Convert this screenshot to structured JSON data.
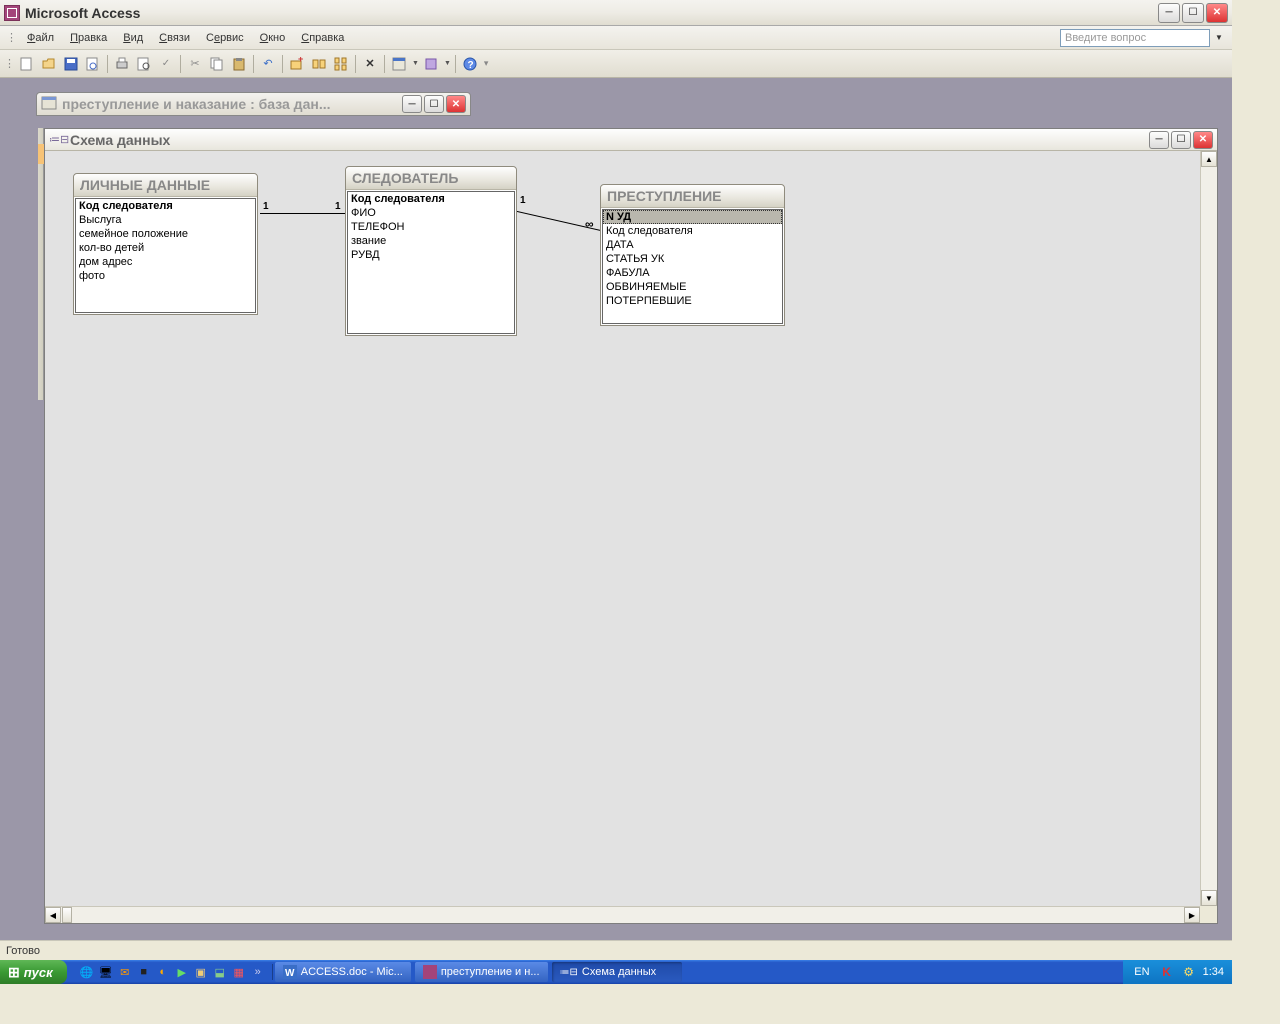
{
  "app": {
    "title": "Microsoft Access"
  },
  "menu": {
    "file": "Файл",
    "edit": "Правка",
    "view": "Вид",
    "relations": "Связи",
    "service": "Сервис",
    "window": "Окно",
    "help": "Справка"
  },
  "help_search_placeholder": "Введите вопрос",
  "db_window": {
    "title": "преступление и наказание : база дан..."
  },
  "schema_window": {
    "title": "Схема данных"
  },
  "tables": {
    "t1": {
      "title": "ЛИЧНЫЕ ДАННЫЕ",
      "fields": [
        "Код следователя",
        "Выслуга",
        "семейное положение",
        "кол-во детей",
        "дом  адрес",
        "фото"
      ]
    },
    "t2": {
      "title": "СЛЕДОВАТЕЛЬ",
      "fields": [
        "Код следователя",
        "ФИО",
        "ТЕЛЕФОН",
        "звание",
        "РУВД"
      ]
    },
    "t3": {
      "title": "ПРЕСТУПЛЕНИЕ",
      "fields": [
        "N УД",
        "Код следователя",
        "ДАТА",
        "СТАТЬЯ УК",
        "ФАБУЛА",
        "ОБВИНЯЕМЫЕ",
        "ПОТЕРПЕВШИЕ"
      ]
    }
  },
  "rel": {
    "one": "1",
    "many": "∞"
  },
  "status": "Готово",
  "taskbar": {
    "start": "пуск",
    "items": [
      {
        "label": "ACCESS.doc - Mic..."
      },
      {
        "label": "преступление и н..."
      },
      {
        "label": "Схема данных"
      }
    ],
    "lang": "EN",
    "time": "1:34"
  }
}
